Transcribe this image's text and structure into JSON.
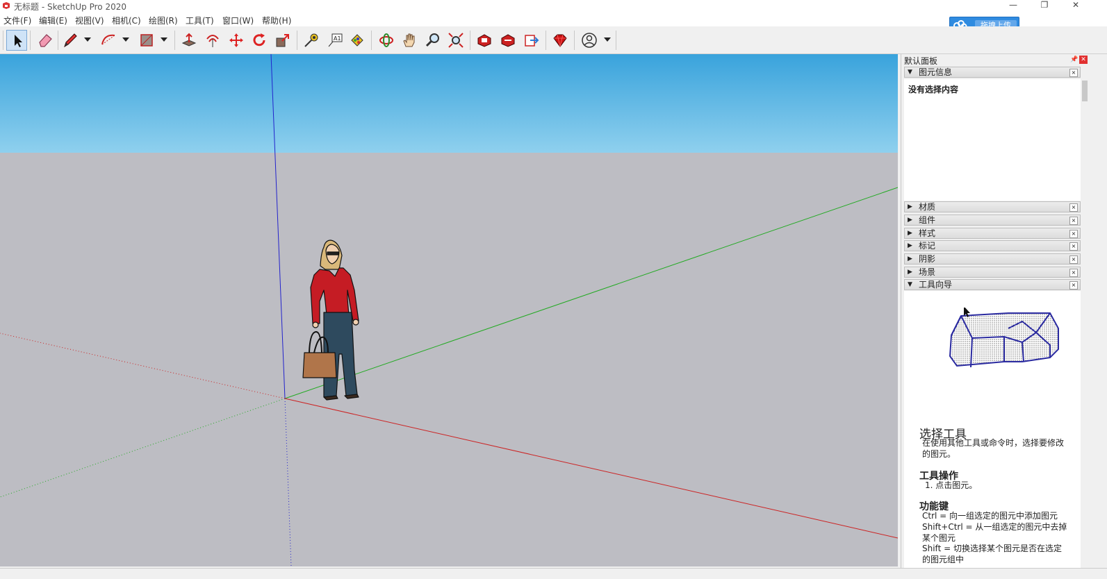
{
  "window": {
    "title": "无标题 - SketchUp Pro 2020",
    "controls": [
      "—",
      "❐",
      "✕"
    ]
  },
  "menu": [
    "文件(F)",
    "编辑(E)",
    "视图(V)",
    "相机(C)",
    "绘图(R)",
    "工具(T)",
    "窗口(W)",
    "帮助(H)"
  ],
  "toolbar": {
    "tools": [
      "select-tool",
      "eraser-tool",
      "pencil-tool",
      "arc-tool",
      "rectangle-tool",
      "push-pull-tool",
      "offset-tool",
      "move-tool",
      "rotate-tool",
      "scale-tool",
      "tape-measure-tool",
      "text-tool",
      "paint-bucket-tool",
      "orbit-tool",
      "pan-tool",
      "zoom-tool",
      "zoom-extents-tool",
      "warehouse-tool",
      "extension-warehouse-tool",
      "layout-send-tool",
      "ruby-tool",
      "account-tool"
    ],
    "active": "select-tool"
  },
  "upload": {
    "label": "拖拽上传"
  },
  "colors": {
    "sky_top": "#39a3dc",
    "sky_bottom": "#8fd0ee",
    "ground": "#bdbdc3",
    "axis_red": "#cc2222",
    "axis_green": "#22aa22",
    "axis_blue": "#2222cc"
  },
  "tray": {
    "title": "默认面板",
    "entity_info": {
      "label": "图元信息",
      "content": "没有选择内容"
    },
    "sections": [
      "材质",
      "组件",
      "样式",
      "标记",
      "阴影",
      "场景",
      "工具向导"
    ],
    "instructor": {
      "tool_name": "选择工具",
      "description": "在使用其他工具或命令时，选择要修改的图元。",
      "ops_heading": "工具操作",
      "op1": "1. 点击图元。",
      "keys_heading": "功能键",
      "key1": "Ctrl = 向一组选定的图元中添加图元",
      "key2": "Shift+Ctrl = 从一组选定的图元中去掉某个图元",
      "key3": "Shift = 切换选择某个图元是否在选定的图元组中"
    }
  }
}
